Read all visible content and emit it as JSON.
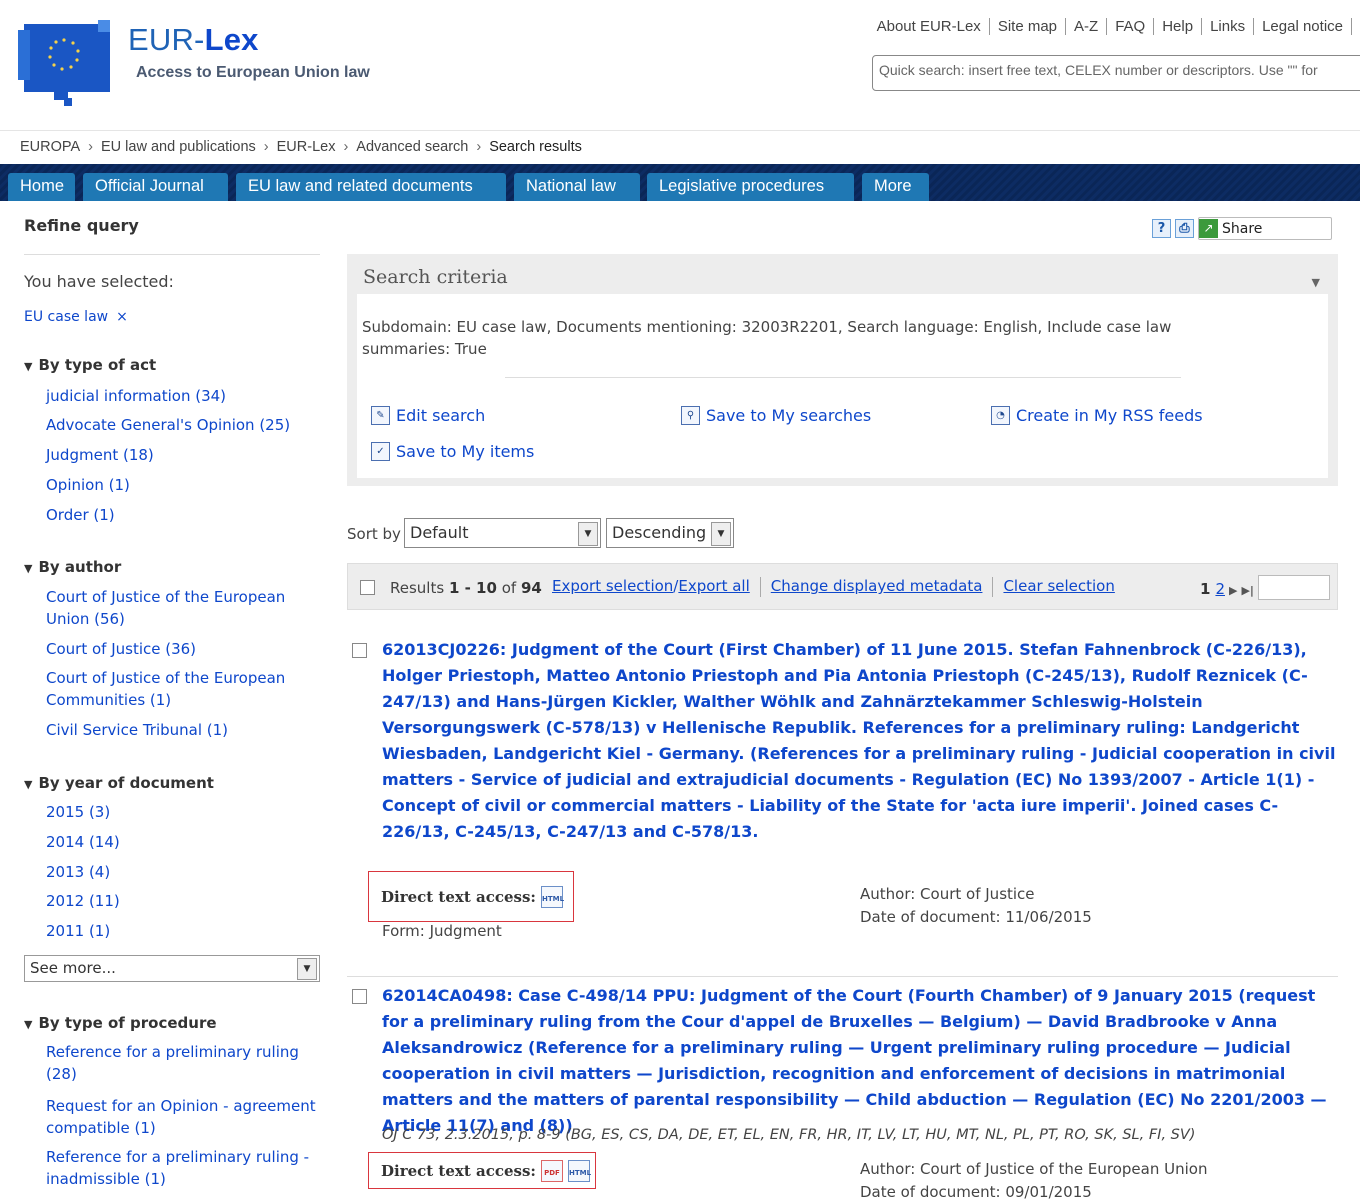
{
  "header": {
    "brand_a": "EUR-",
    "brand_b": "Lex",
    "tagline": "Access to European Union law",
    "top_links": [
      "About EUR-Lex",
      "Site map",
      "A-Z",
      "FAQ",
      "Help",
      "Links",
      "Legal notice"
    ],
    "quick_search_placeholder": "Quick search: insert free text, CELEX number or descriptors. Use \"\" for"
  },
  "breadcrumb": [
    "EUROPA",
    "EU law and publications",
    "EUR-Lex",
    "Advanced search",
    "Search results"
  ],
  "nav": [
    "Home",
    "Official Journal",
    "EU law and related documents",
    "National law",
    "Legislative procedures",
    "More"
  ],
  "sidebar": {
    "refine": "Refine query",
    "you_have_selected": "You have selected:",
    "selected_filter": "EU case law",
    "remove_symbol": "×",
    "facets": [
      {
        "title": "By type of act",
        "items": [
          "judicial information (34)",
          "Advocate General's Opinion (25)",
          "Judgment (18)",
          "Opinion (1)",
          "Order (1)"
        ]
      },
      {
        "title": "By author",
        "items": [
          "Court of Justice of the European Union (56)",
          "Court of Justice (36)",
          "Court of Justice of the European Communities (1)",
          "Civil Service Tribunal (1)"
        ]
      },
      {
        "title": "By year of document",
        "items": [
          "2015 (3)",
          "2014 (14)",
          "2013 (4)",
          "2012 (11)",
          "2011 (1)"
        ]
      },
      {
        "title": "By type of procedure",
        "items": [
          "Reference for a preliminary ruling (28)",
          "Request for an Opinion - agreement compatible (1)",
          "Reference for a preliminary ruling - inadmissible (1)"
        ]
      }
    ],
    "see_more": "See more..."
  },
  "tools": {
    "help": "?",
    "print": "⎙",
    "share": "Share"
  },
  "criteria": {
    "title": "Search criteria",
    "description": "Subdomain: EU case law, Documents mentioning: 32003R2201, Search language: English, Include case law summaries: True",
    "actions": [
      "Edit search",
      "Save to My searches",
      "Create in My RSS feeds",
      "Save to My items"
    ]
  },
  "sort": {
    "label": "Sort by",
    "field": "Default",
    "order": "Descending"
  },
  "results_bar": {
    "prefix": "Results",
    "range": "1 - 10",
    "of": "of",
    "total": "94",
    "export_selection": "Export selection",
    "slash": "/",
    "export_all": "Export all",
    "change_metadata": "Change displayed metadata",
    "clear_selection": "Clear selection",
    "page_current": "1",
    "page_next": "2"
  },
  "results": [
    {
      "title": "62013CJ0226: Judgment of the Court (First Chamber) of 11 June 2015. Stefan Fahnenbrock (C-226/13), Holger Priestoph, Matteo Antonio Priestoph and Pia Antonia Priestoph (C-245/13), Rudolf Reznicek (C-247/13) and Hans-Jürgen Kickler, Walther Wöhlk and Zahnärztekammer Schleswig-Holstein Versorgungswerk (C-578/13) v Hellenische Republik. References for a preliminary ruling: Landgericht Wiesbaden, Landgericht Kiel - Germany. (References for a preliminary ruling - Judicial cooperation in civil matters - Service of judicial and extrajudicial documents - Regulation (EC) No 1393/2007 - Article 1(1) - Concept of civil or commercial matters - Liability of the State for 'acta iure imperii'. Joined cases C-226/13, C-245/13, C-247/13 and C-578/13.",
      "direct_text": "Direct text access:",
      "author": "Author: Court of Justice",
      "date": "Date of document: 11/06/2015",
      "form": "Form: Judgment"
    },
    {
      "title": "62014CA0498: Case C-498/14 PPU: Judgment of the Court (Fourth Chamber) of 9 January 2015 (request for a preliminary ruling from the Cour d'appel de Bruxelles — Belgium) — David Bradbrooke v Anna Aleksandrowicz (Reference for a preliminary ruling — Urgent preliminary ruling procedure — Judicial cooperation in civil matters — Jurisdiction, recognition and enforcement of decisions in matrimonial matters and the matters of parental responsibility — Child abduction — Regulation (EC) No 2201/2003 — Article 11(7) and (8))",
      "oj": "OJ C 73, 2.3.2015, p. 8-9 (BG, ES, CS, DA, DE, ET, EL, EN, FR, HR, IT, LV, LT, HU, MT, NL, PL, PT, RO, SK, SL, FI, SV)",
      "direct_text": "Direct text access:",
      "author": "Author: Court of Justice of the European Union",
      "date": "Date of document: 09/01/2015"
    }
  ],
  "icons": {
    "pdf": "PDF",
    "html": "HTML"
  }
}
